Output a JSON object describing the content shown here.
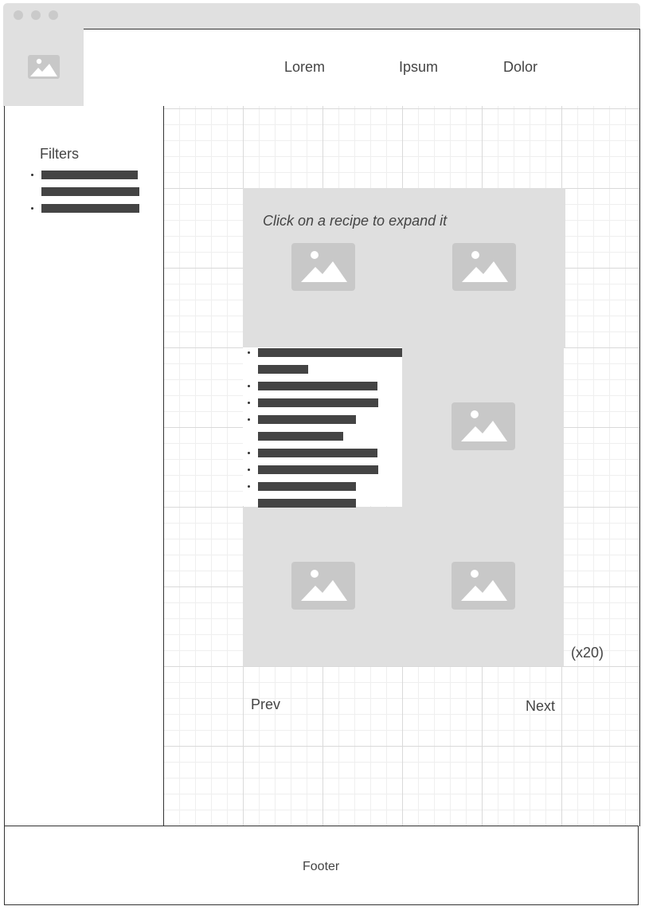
{
  "nav": {
    "items": [
      {
        "label": "Lorem"
      },
      {
        "label": "Ipsum"
      },
      {
        "label": "Dolor"
      }
    ]
  },
  "sidebar": {
    "title": "Filters"
  },
  "content": {
    "hint": "Click on a recipe to expand it",
    "count": "(x20)",
    "prev_label": "Prev",
    "next_label": "Next"
  },
  "footer": {
    "label": "Footer"
  },
  "icons": {
    "logo": "image-placeholder-icon",
    "recipe": "image-placeholder-icon"
  },
  "colors": {
    "placeholder_bg": "#dfdfdf",
    "placeholder_icon": "#c8c8c8",
    "text_bar": "#444444"
  }
}
